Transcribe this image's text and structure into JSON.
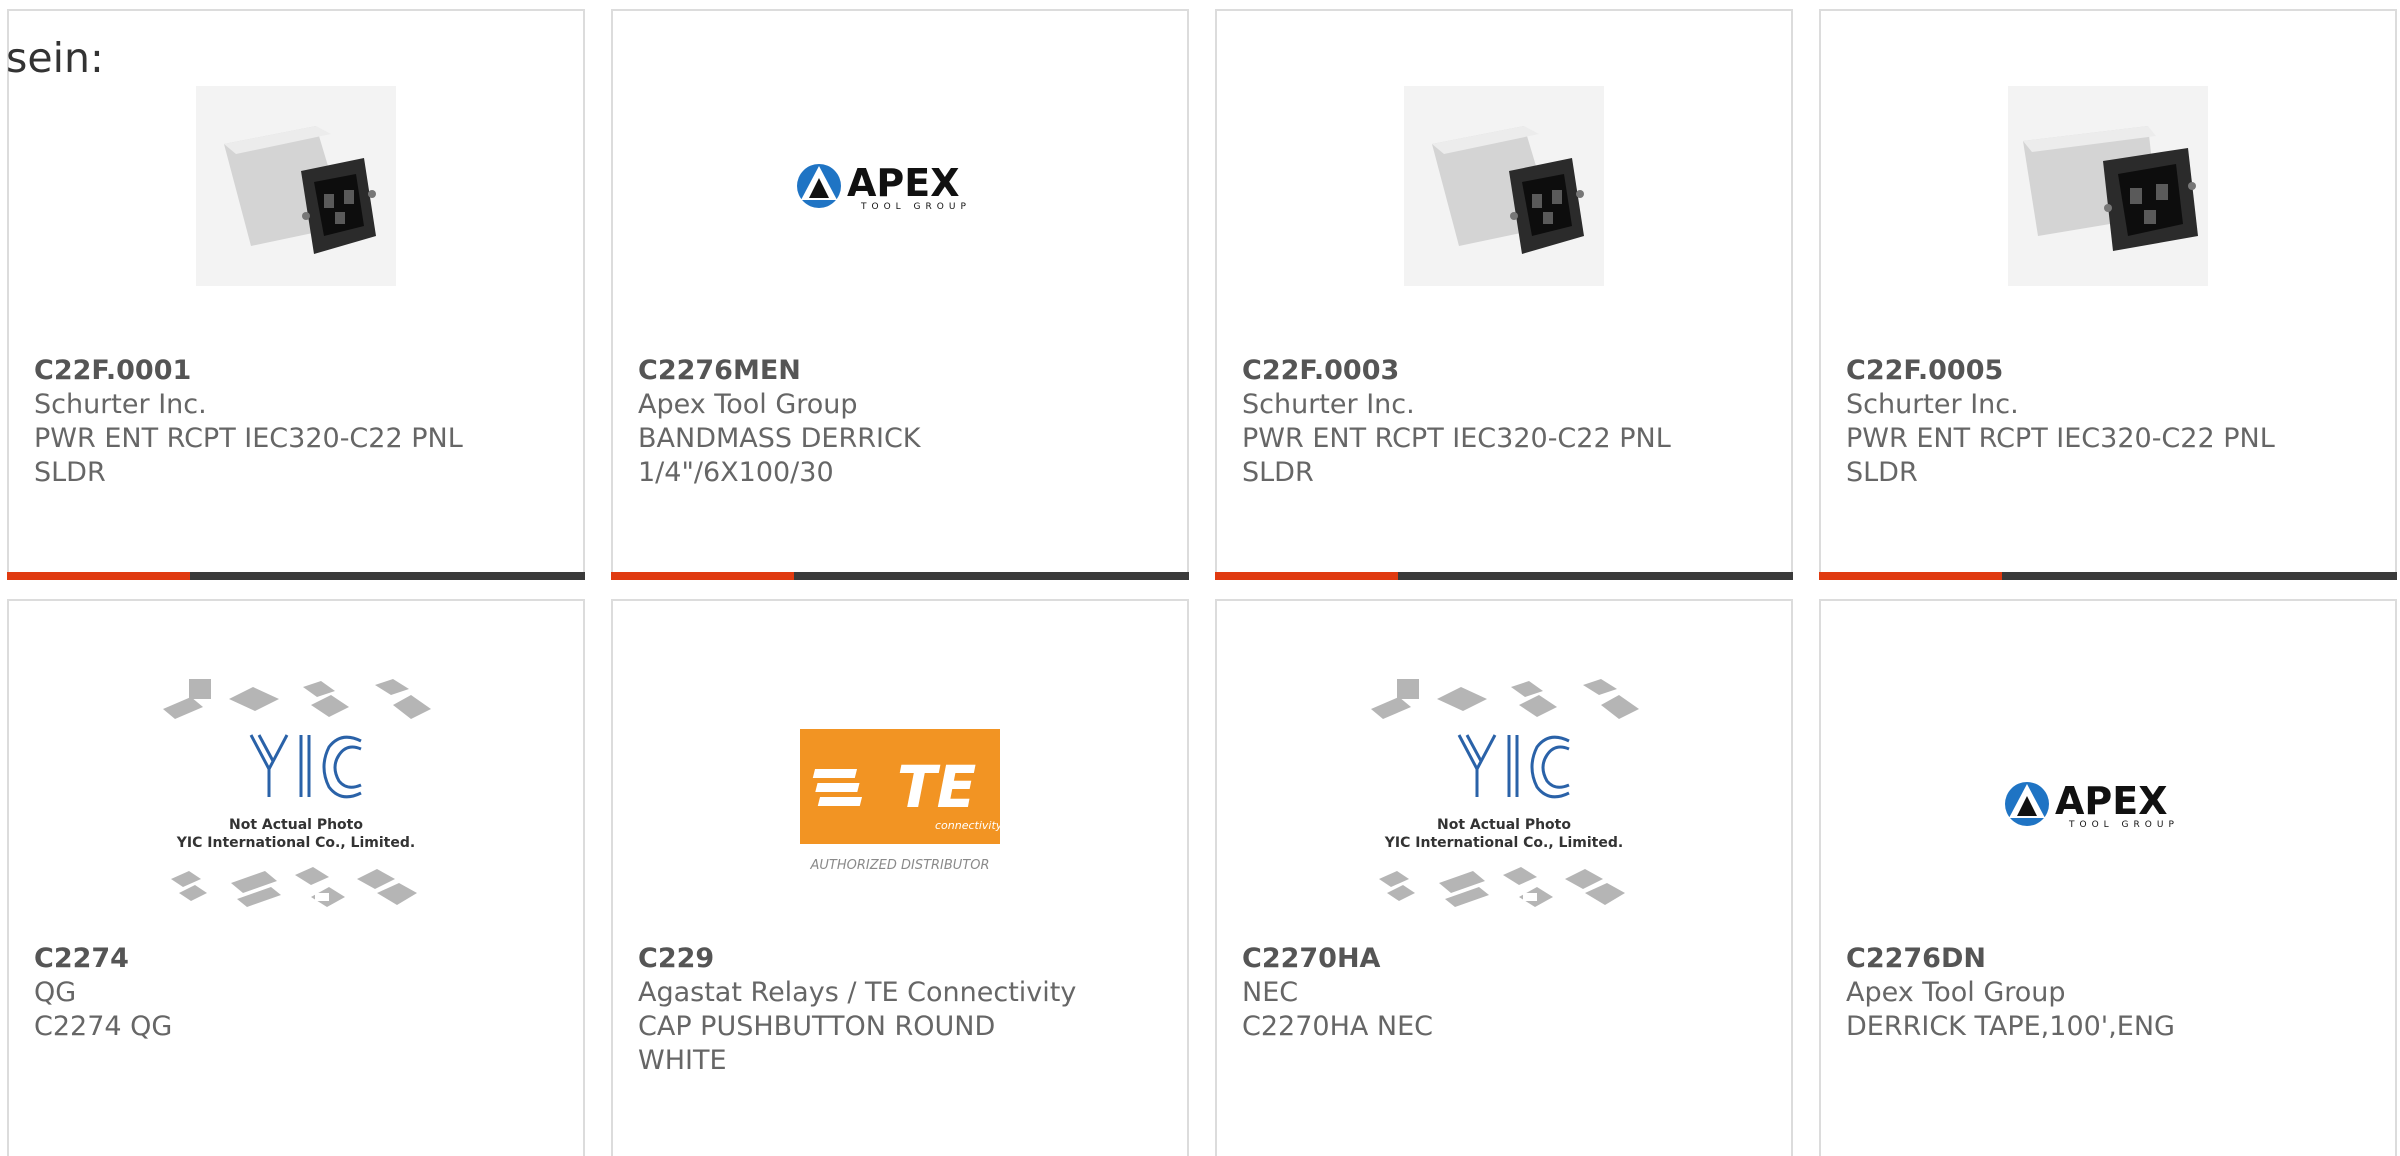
{
  "heading": "sein:",
  "theme": {
    "accent": "#e03a10",
    "bar_dark": "#3a3a3a",
    "border": "#dcdcdc",
    "text": "#666666",
    "te_orange": "#f29423",
    "apex_blue": "#1f74c4"
  },
  "products": [
    {
      "part_number": "C22F.0001",
      "manufacturer": "Schurter Inc.",
      "description": "PWR ENT RCPT IEC320-C22 PNL SLDR",
      "image": "power-entry-connector"
    },
    {
      "part_number": "C2276MEN",
      "manufacturer": "Apex Tool Group",
      "description": "BANDMASS DERRICK 1/4\"/6X100/30",
      "image": "apex-logo"
    },
    {
      "part_number": "C22F.0003",
      "manufacturer": "Schurter Inc.",
      "description": "PWR ENT RCPT IEC320-C22 PNL SLDR",
      "image": "power-entry-connector"
    },
    {
      "part_number": "C22F.0005",
      "manufacturer": "Schurter Inc.",
      "description": "PWR ENT RCPT IEC320-C22 PNL SLDR",
      "image": "power-entry-connector"
    },
    {
      "part_number": "C2274",
      "manufacturer": "QG",
      "description": "C2274 QG",
      "image": "yic-placeholder"
    },
    {
      "part_number": "C229",
      "manufacturer": "Agastat Relays / TE Connectivity",
      "description": "CAP PUSHBUTTON ROUND WHITE",
      "image": "te-logo"
    },
    {
      "part_number": "C2270HA",
      "manufacturer": "NEC",
      "description": "C2270HA NEC",
      "image": "yic-placeholder"
    },
    {
      "part_number": "C2276DN",
      "manufacturer": "Apex Tool Group",
      "description": "DERRICK TAPE,100',ENG",
      "image": "apex-logo"
    }
  ],
  "logos": {
    "apex": {
      "name": "APEX",
      "tagline": "TOOL GROUP"
    },
    "te": {
      "name": "TE",
      "tagline": "connectivity",
      "caption": "AUTHORIZED DISTRIBUTOR"
    },
    "yic": {
      "name": "YIC",
      "line1": "Not Actual Photo",
      "line2": "YIC International Co., Limited."
    }
  }
}
